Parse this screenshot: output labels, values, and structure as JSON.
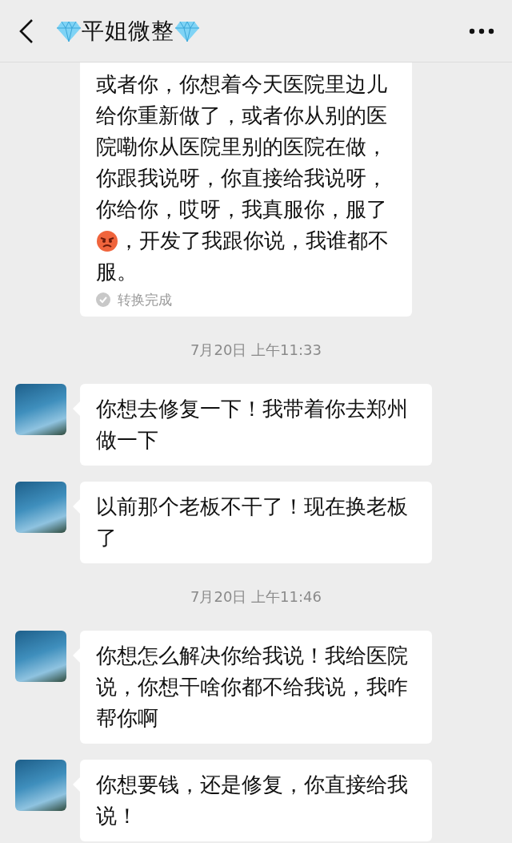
{
  "header": {
    "title": "平姐微整"
  },
  "messages": [
    {
      "kind": "voice_text",
      "text_before": "或者你，你想着今天医院里边儿给你重新做了，或者你从别的医院嘞你从医院里别的医院在做，你跟我说呀，你直接给我说呀，你给你，哎呀，我真服你，服了",
      "text_after": [
        "，开发了我跟你说，我谁都不",
        "服。"
      ],
      "status": "转换完成"
    },
    {
      "kind": "time",
      "text": "7月20日 上午11:33"
    },
    {
      "kind": "text",
      "text": "你想去修复一下！我带着你去郑州做一下"
    },
    {
      "kind": "text",
      "text": "以前那个老板不干了！现在换老板了"
    },
    {
      "kind": "time",
      "text": "7月20日 上午11:46"
    },
    {
      "kind": "text",
      "text": "你想怎么解决你给我说！我给医院说，你想干啥你都不给我说，我咋帮你啊"
    },
    {
      "kind": "text",
      "text": "你想要钱，还是修复，你直接给我说！"
    }
  ]
}
